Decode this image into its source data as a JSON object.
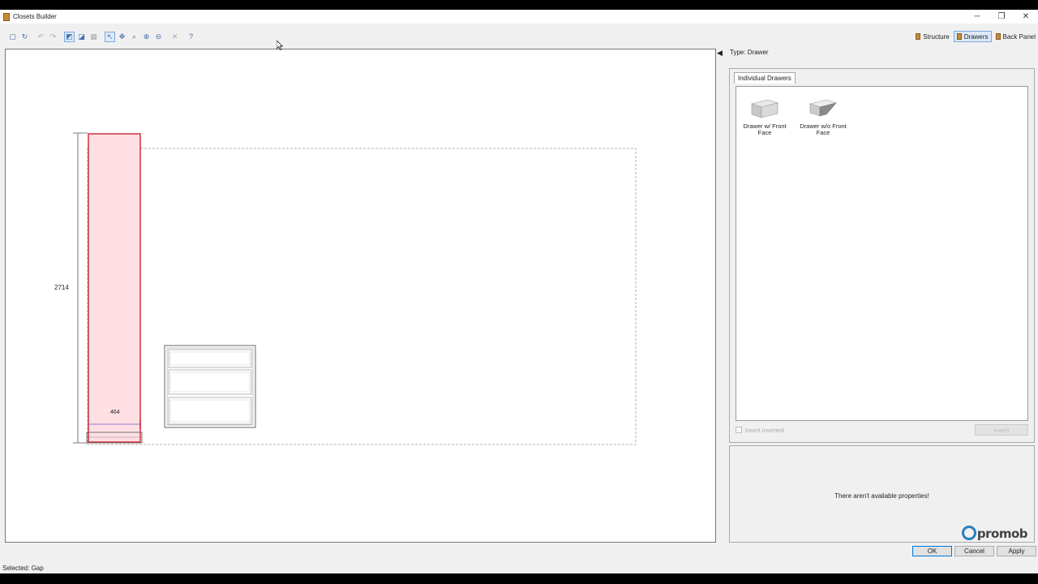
{
  "window": {
    "title": "Closets Builder"
  },
  "window_controls": {
    "minimize": "─",
    "restore": "❐",
    "close": "✕"
  },
  "toolbar": {
    "buttons": [
      {
        "icon": "new-doc-icon",
        "glyph": "▢",
        "state": "normal"
      },
      {
        "icon": "refresh-icon",
        "glyph": "↻",
        "state": "normal"
      },
      {
        "icon": "undo-icon",
        "glyph": "↶",
        "state": "disabled"
      },
      {
        "icon": "redo-icon",
        "glyph": "↷",
        "state": "disabled"
      },
      {
        "icon": "view-2d-icon",
        "glyph": "◩",
        "state": "active"
      },
      {
        "icon": "view-3d-icon",
        "glyph": "◪",
        "state": "normal"
      },
      {
        "icon": "grid-icon",
        "glyph": "▦",
        "state": "disabled"
      },
      {
        "icon": "select-pointer-icon",
        "glyph": "↖",
        "state": "active"
      },
      {
        "icon": "pan-icon",
        "glyph": "✥",
        "state": "normal"
      },
      {
        "icon": "zoom-window-icon",
        "glyph": "⌕",
        "state": "normal"
      },
      {
        "icon": "zoom-in-icon",
        "glyph": "⊕",
        "state": "normal"
      },
      {
        "icon": "zoom-out-icon",
        "glyph": "⊖",
        "state": "normal"
      },
      {
        "icon": "delete-icon",
        "glyph": "✕",
        "state": "disabled"
      },
      {
        "icon": "help-icon",
        "glyph": "?",
        "state": "normal"
      }
    ]
  },
  "tabs": [
    {
      "label": "Structure",
      "active": false
    },
    {
      "label": "Drawers",
      "active": true
    },
    {
      "label": "Back Panel",
      "active": false
    }
  ],
  "canvas": {
    "dimension_height": "2714",
    "dimension_gap": "464"
  },
  "panel": {
    "type_label": "Type: Drawer",
    "group_tab": "Individual Drawers",
    "items": [
      {
        "label": "Drawer w/ Front Face"
      },
      {
        "label": "Drawer w/o  Front Face"
      }
    ],
    "insert_inverted": "Insert inverted",
    "insert_button": "Insert",
    "no_properties": "There aren't available properties!",
    "logo_text": "promob"
  },
  "dialog": {
    "ok": "OK",
    "cancel": "Cancel",
    "apply": "Apply"
  },
  "status": {
    "text": "Selected: Gap"
  },
  "colors": {
    "accent": "#0078d7",
    "selection_red": "#cc2233",
    "selection_fill": "#ffdfe3"
  }
}
